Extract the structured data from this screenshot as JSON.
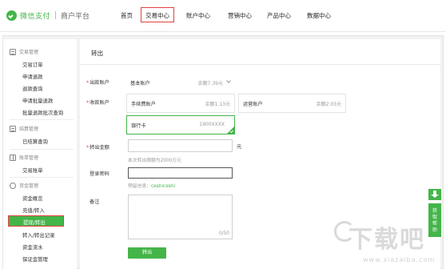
{
  "brand": {
    "name": "微信支付",
    "platform": "商户平台"
  },
  "nav": [
    "首页",
    "交易中心",
    "账户中心",
    "营销中心",
    "产品中心",
    "数据中心"
  ],
  "nav_active": "交易中心",
  "sidebar": {
    "groups": [
      {
        "title": "交易管理",
        "icon": "list-icon",
        "items": [
          "交易订单",
          "申请退款",
          "退款查询",
          "申请批量退款",
          "批量退款批次查询"
        ]
      },
      {
        "title": "结算管理",
        "icon": "settlement-icon",
        "items": [
          "已结算查询"
        ]
      },
      {
        "title": "账单管理",
        "icon": "bill-icon",
        "items": [
          "交易账单"
        ]
      },
      {
        "title": "资金管理",
        "icon": "funds-icon",
        "items": [
          "资金概览",
          "充值/转入",
          "提现/转出",
          "转入/转出记录",
          "资金流水",
          "保证金管理"
        ]
      }
    ],
    "active_item": "提现/转出"
  },
  "page": {
    "title": "转出",
    "payout_account": {
      "label": "出款账户",
      "value": "基本账户",
      "balance_prefix": "余额",
      "balance": "7.39元"
    },
    "receive_account": {
      "label": "收款账户",
      "options": [
        {
          "name": "手续费账户",
          "balance": "余额1.13元"
        },
        {
          "name": "运营账户",
          "balance": "余额2.03元"
        },
        {
          "name": "银行卡",
          "balance": "1900XXXX"
        }
      ],
      "selected": "银行卡"
    },
    "amount": {
      "label": "转出金额",
      "unit": "元",
      "hint": "本次转出限额为2000万元"
    },
    "password": {
      "label": "登录密码",
      "hint_prefix": "预留信息：",
      "hint_value": "ceshiceshi"
    },
    "note": {
      "label": "备注",
      "counter": "0/50"
    },
    "submit_label": "转出"
  },
  "float": {
    "download_icon": "download-icon",
    "help_text": [
      "获",
      "取",
      "帮",
      "助"
    ]
  },
  "watermark": {
    "big": "下载吧",
    "small": "www.xiazaiba.com"
  },
  "colors": {
    "brand_green": "#44b549",
    "highlight_red": "#e0413c"
  }
}
